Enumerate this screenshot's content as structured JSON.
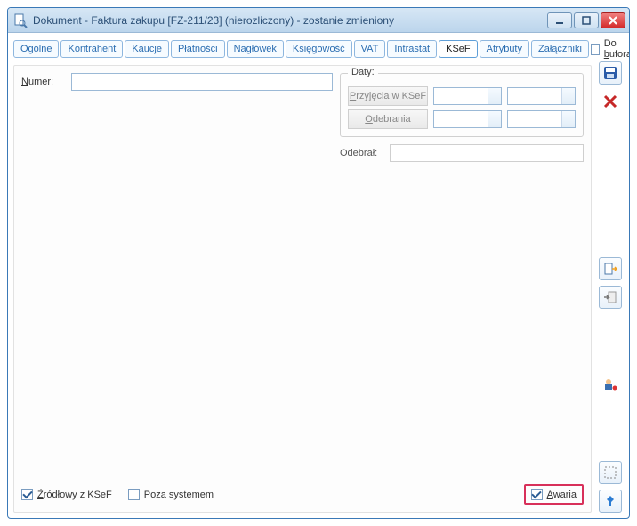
{
  "window": {
    "title": "Dokument - Faktura zakupu [FZ-211/23] (nierozliczony) - zostanie zmieniony"
  },
  "tabs": {
    "items": [
      {
        "label": "Ogólne"
      },
      {
        "label": "Kontrahent"
      },
      {
        "label": "Kaucje"
      },
      {
        "label": "Płatności"
      },
      {
        "label": "Nagłówek"
      },
      {
        "label": "Księgowość"
      },
      {
        "label": "VAT"
      },
      {
        "label": "Intrastat"
      },
      {
        "label": "KSeF"
      },
      {
        "label": "Atrybuty"
      },
      {
        "label": "Załączniki"
      }
    ],
    "active_index": 8,
    "buffer_label": "Do bufora",
    "buffer_underline": "b",
    "buffer_checked": false
  },
  "form": {
    "numer_label": "Numer:",
    "numer_underline": "N",
    "numer_value": "",
    "daty_group": "Daty:",
    "przyjecia_label": "Przyjęcia w KSeF",
    "przyjecia_underline": "P",
    "przyjecia_date": "",
    "przyjecia_time": "",
    "odebrania_label": "Odebrania",
    "odebrania_underline": "O",
    "odebrania_date": "",
    "odebrania_time": "",
    "odebral_label": "Odebrał:",
    "odebral_value": ""
  },
  "footer": {
    "src_label": "Źródłowy z KSeF",
    "src_underline": "Ź",
    "src_checked": true,
    "poza_label": "Poza systemem",
    "poza_checked": false,
    "awaria_label": "Awaria",
    "awaria_underline": "A",
    "awaria_checked": true
  }
}
